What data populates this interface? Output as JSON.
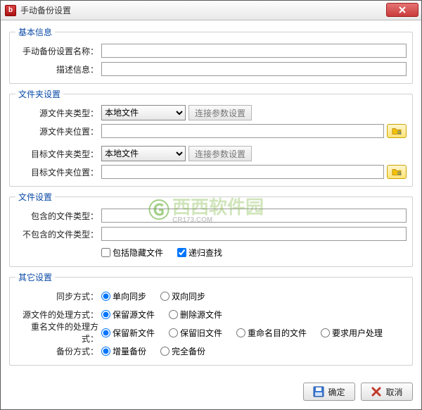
{
  "title": "手动备份设置",
  "groups": {
    "basic": {
      "legend": "基本信息",
      "name_label": "手动备份设置名称：",
      "name_value": "",
      "desc_label": "描述信息：",
      "desc_value": ""
    },
    "folder": {
      "legend": "文件夹设置",
      "src_type_label": "源文件夹类型：",
      "src_type_value": "本地文件",
      "src_type_options": [
        "本地文件"
      ],
      "conn_btn": "连接参数设置",
      "src_path_label": "源文件夹位置：",
      "src_path_value": "",
      "dst_type_label": "目标文件夹类型：",
      "dst_type_value": "本地文件",
      "dst_type_options": [
        "本地文件"
      ],
      "dst_path_label": "目标文件夹位置：",
      "dst_path_value": ""
    },
    "file": {
      "legend": "文件设置",
      "include_label": "包含的文件类型：",
      "include_value": "",
      "exclude_label": "不包含的文件类型：",
      "exclude_value": "",
      "hidden_chk": "包括隐藏文件",
      "hidden_checked": false,
      "recurse_chk": "递归查找",
      "recurse_checked": true
    },
    "other": {
      "legend": "其它设置",
      "sync_label": "同步方式：",
      "sync_options": [
        "单向同步",
        "双向同步"
      ],
      "sync_selected": 0,
      "src_handle_label": "源文件的处理方式：",
      "src_handle_options": [
        "保留源文件",
        "删除源文件"
      ],
      "src_handle_selected": 0,
      "dup_label": "重名文件的处理方式：",
      "dup_options": [
        "保留新文件",
        "保留旧文件",
        "重命名目的文件",
        "要求用户处理"
      ],
      "dup_selected": 0,
      "backup_label": "备份方式：",
      "backup_options": [
        "增量备份",
        "完全备份"
      ],
      "backup_selected": 0
    }
  },
  "buttons": {
    "ok": "确定",
    "cancel": "取消"
  },
  "watermark": {
    "brand": "西西软件园",
    "sub": "CR173.COM"
  }
}
